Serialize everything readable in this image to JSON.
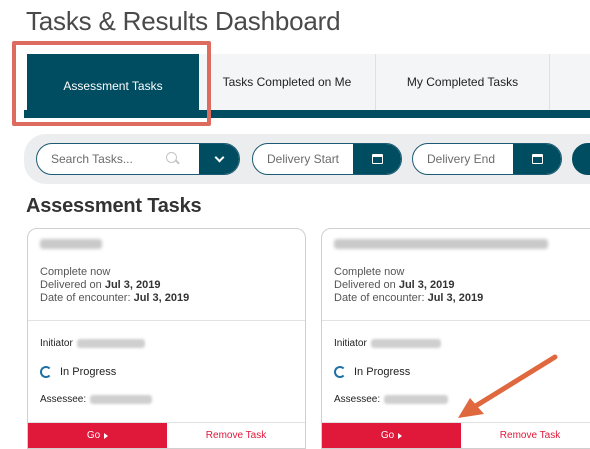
{
  "page": {
    "title": "Tasks & Results Dashboard"
  },
  "tabs": [
    {
      "label": "Assessment Tasks",
      "active": true
    },
    {
      "label": "Tasks Completed on Me"
    },
    {
      "label": "My Completed Tasks"
    }
  ],
  "filters": {
    "search_placeholder": "Search Tasks...",
    "delivery_start": "Delivery Start",
    "delivery_end": "Delivery End"
  },
  "section": {
    "heading": "Assessment Tasks"
  },
  "cards": [
    {
      "status_line": "Complete now",
      "delivered_label": "Delivered on",
      "delivered_date": "Jul 3, 2019",
      "encounter_label": "Date of encounter:",
      "encounter_date": "Jul 3, 2019",
      "initiator_label": "Initiator",
      "progress": "In Progress",
      "assessee_label": "Assessee:",
      "go_label": "Go",
      "remove_label": "Remove Task"
    },
    {
      "status_line": "Complete now",
      "delivered_label": "Delivered on",
      "delivered_date": "Jul 3, 2019",
      "encounter_label": "Date of encounter:",
      "encounter_date": "Jul 3, 2019",
      "initiator_label": "Initiator",
      "progress": "In Progress",
      "assessee_label": "Assessee:",
      "go_label": "Go",
      "remove_label": "Remove Task"
    }
  ],
  "colors": {
    "brand": "#004d61",
    "danger": "#e0183a",
    "annotation": "#dd6b60"
  }
}
